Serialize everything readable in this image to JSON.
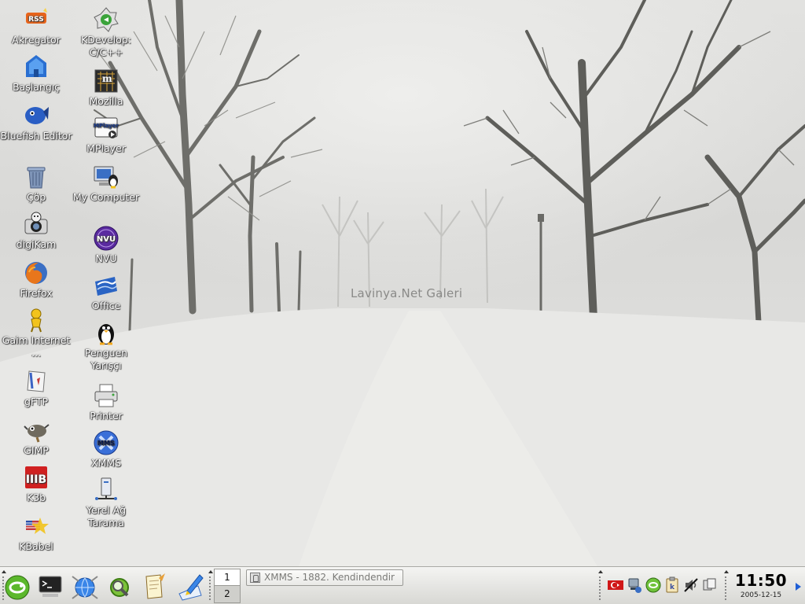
{
  "wallpaper": {
    "caption": "Lavinya.Net Galeri"
  },
  "desktop_icons": [
    {
      "label": "Akregator",
      "icon": "rss-feed-icon"
    },
    {
      "label": "Başlangıç",
      "icon": "home-icon"
    },
    {
      "label": "Bluefish Editor",
      "icon": "bluefish-icon"
    },
    {
      "label": "Çöp",
      "icon": "trash-icon"
    },
    {
      "label": "digiKam",
      "icon": "camera-icon"
    },
    {
      "label": "Firefox",
      "icon": "firefox-icon"
    },
    {
      "label": "Gaim Internet ...",
      "icon": "gaim-icon"
    },
    {
      "label": "gFTP",
      "icon": "ftp-icon"
    },
    {
      "label": "GIMP",
      "icon": "gimp-icon"
    },
    {
      "label": "K3b",
      "icon": "k3b-icon"
    },
    {
      "label": "KBabel",
      "icon": "kbabel-icon"
    },
    {
      "label": "KDevelop: C/C++",
      "icon": "kdevelop-icon"
    },
    {
      "label": "Mozilla",
      "icon": "mozilla-icon"
    },
    {
      "label": "MPlayer",
      "icon": "mplayer-icon"
    },
    {
      "label": "My Computer",
      "icon": "computer-icon"
    },
    {
      "label": "NVU",
      "icon": "nvu-icon"
    },
    {
      "label": "Office",
      "icon": "office-icon"
    },
    {
      "label": "Penguen Yarışçı",
      "icon": "penguin-icon"
    },
    {
      "label": "Printer",
      "icon": "printer-icon"
    },
    {
      "label": "XMMS",
      "icon": "xmms-icon"
    },
    {
      "label": "Yerel Ağ Tarama",
      "icon": "network-icon"
    }
  ],
  "panel": {
    "launchers": [
      {
        "name": "kmenu",
        "icon": "suse-menu-icon"
      },
      {
        "name": "terminal",
        "icon": "terminal-icon"
      },
      {
        "name": "browser",
        "icon": "konqueror-icon"
      },
      {
        "name": "search",
        "icon": "search-icon"
      },
      {
        "name": "notes",
        "icon": "notes-icon"
      },
      {
        "name": "editor",
        "icon": "write-icon"
      }
    ],
    "pager": {
      "desktop1": "1",
      "desktop2": "2",
      "active": 1
    },
    "taskbar": [
      {
        "title": "XMMS - 1882. Kendindendir",
        "icon": "app-icon"
      }
    ],
    "tray": [
      {
        "icon": "flag-icon"
      },
      {
        "icon": "network-status-icon"
      },
      {
        "icon": "update-icon"
      },
      {
        "icon": "clipboard-icon"
      },
      {
        "icon": "mute-icon"
      },
      {
        "icon": "copy-icon"
      }
    ],
    "clock": {
      "time": "11:50",
      "date": "2005-12-15"
    }
  }
}
